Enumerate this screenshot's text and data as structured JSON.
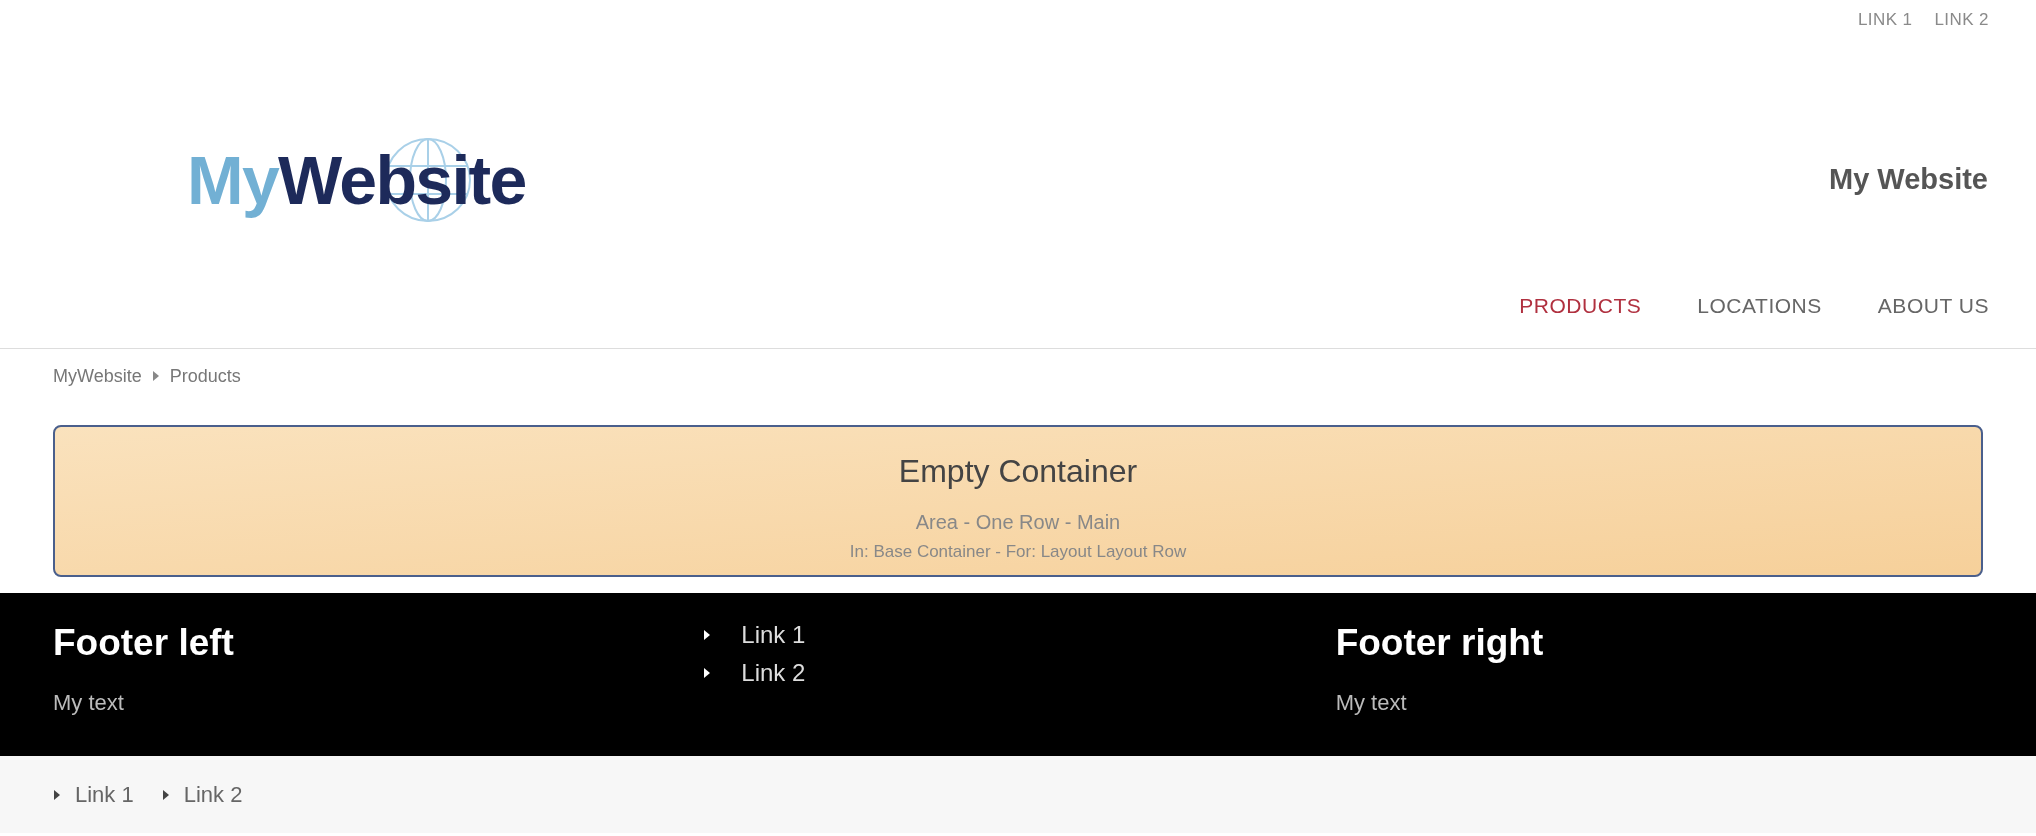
{
  "top_links": [
    "LINK 1",
    "LINK 2"
  ],
  "logo": {
    "light_part": "My",
    "dark_part": "Website"
  },
  "site_title": "My Website",
  "nav": [
    {
      "label": "PRODUCTS",
      "selected": true
    },
    {
      "label": "LOCATIONS",
      "selected": false
    },
    {
      "label": "ABOUT US",
      "selected": false
    }
  ],
  "breadcrumb": [
    "MyWebsite",
    "Products"
  ],
  "container": {
    "title": "Empty Container",
    "subtitle": "Area - One Row - Main",
    "detail": "In: Base Container - For: Layout Layout Row"
  },
  "footer": {
    "left": {
      "heading": "Footer left",
      "text": "My text"
    },
    "links": [
      "Link 1",
      "Link 2"
    ],
    "right": {
      "heading": "Footer right",
      "text": "My text"
    }
  },
  "bottom_links": [
    "Link 1",
    "Link 2"
  ]
}
